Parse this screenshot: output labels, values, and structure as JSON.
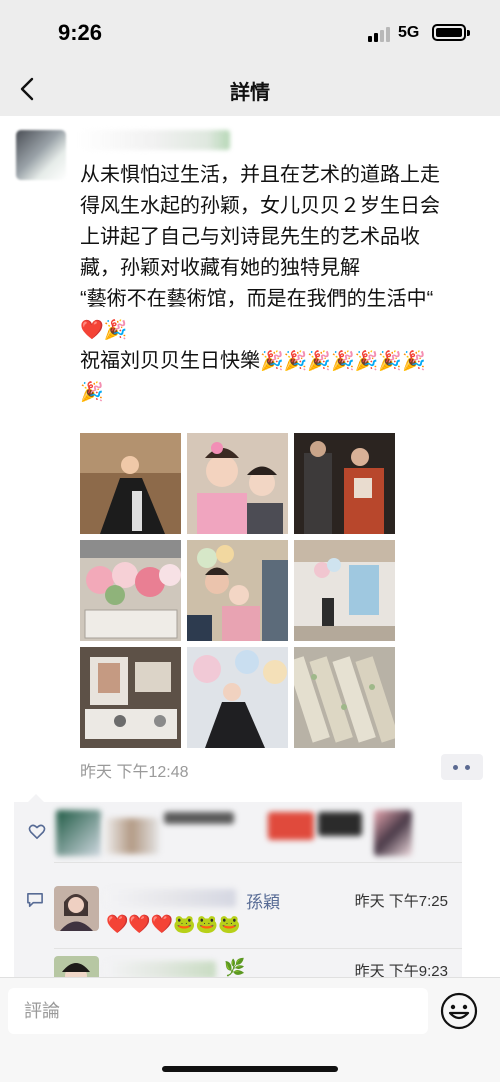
{
  "status_bar": {
    "time": "9:26",
    "network": "5G",
    "battery_level": 0.85
  },
  "nav": {
    "title": "詳情",
    "back_icon": "chevron-left-icon"
  },
  "post": {
    "lines": [
      "从未惧怕过生活，并且在艺术的道路上走",
      "得风生水起的孙颖，女儿贝贝２岁生日会",
      "上讲起了自己与刘诗昆先生的艺术品收",
      "藏，孙颖对收藏有她的独特見解",
      "“藝術不在藝術馆，而是在我們的生活中“"
    ],
    "emoji_line": "❤️🎉",
    "greeting": "祝福刘贝贝生日快樂",
    "greeting_emojis": "🎉🎉🎉🎉🎉🎉🎉",
    "trailing_emoji": "🎉",
    "time": "昨天 下午12:48",
    "photo_count": 9
  },
  "likes": {
    "icon": "heart-outline-icon"
  },
  "comments": [
    {
      "name_suffix": "孫穎",
      "time": "昨天 下午7:25",
      "text": "❤️❤️❤️🐸🐸🐸"
    },
    {
      "name_suffix": "🌿",
      "time": "昨天 下午9:23",
      "text": ""
    }
  ],
  "input": {
    "placeholder": "評論",
    "emoji_icon": "smiley-face-icon"
  },
  "colors": {
    "nav_bg": "#ededed",
    "link": "#576b95",
    "comment_bg": "#f3f3f5"
  }
}
